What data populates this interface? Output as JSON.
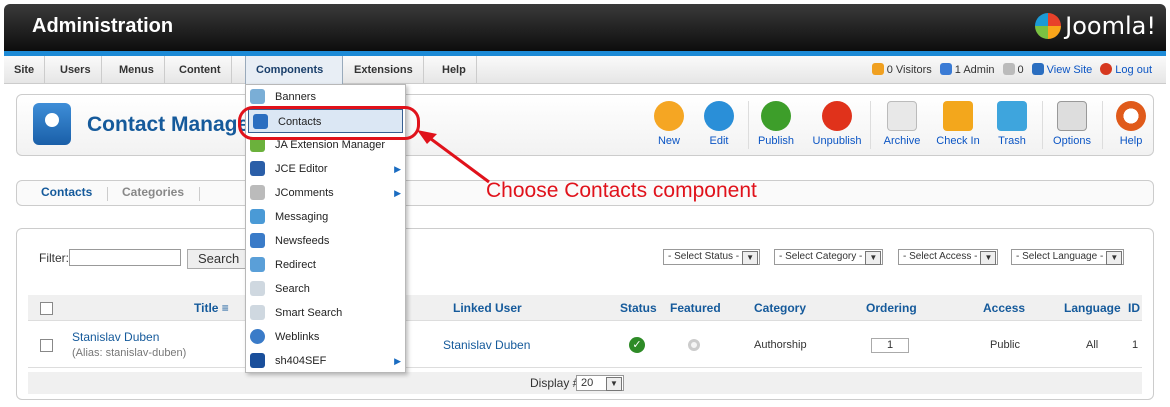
{
  "header": {
    "title": "Administration",
    "logo_text": "Joomla!"
  },
  "menubar": {
    "items": [
      "Site",
      "Users",
      "Menus",
      "Content",
      "Components",
      "Extensions",
      "Help"
    ],
    "active": "Components"
  },
  "status": {
    "visitors": "0 Visitors",
    "admin": "1 Admin",
    "messages": "0",
    "view_site": "View Site",
    "logout": "Log out"
  },
  "toolbar": {
    "page_title": "Contact Manage",
    "buttons": [
      "New",
      "Edit",
      "Publish",
      "Unpublish",
      "Archive",
      "Check In",
      "Trash",
      "Options",
      "Help"
    ]
  },
  "subnav": {
    "items": [
      "Contacts",
      "Categories"
    ],
    "active": "Contacts"
  },
  "filter": {
    "label": "Filter:",
    "value": "",
    "search_label": "Search"
  },
  "selects": [
    "- Select Status -",
    "- Select Category -",
    "- Select Access -",
    "- Select Language -"
  ],
  "table": {
    "columns": [
      "Title",
      "Linked User",
      "Status",
      "Featured",
      "Category",
      "Ordering",
      "Access",
      "Language",
      "ID"
    ],
    "rows": [
      {
        "title": "Stanislav Duben",
        "alias": "(Alias: stanislav-duben)",
        "linked_user": "Stanislav Duben",
        "status": "published",
        "featured": "no",
        "category": "Authorship",
        "ordering": "1",
        "access": "Public",
        "language": "All",
        "id": "1"
      }
    ]
  },
  "footer": {
    "display_label": "Display #",
    "display_value": "20"
  },
  "dropdown": {
    "items": [
      {
        "label": "Banners",
        "icon": "banner-icon",
        "submenu": false
      },
      {
        "label": "Contacts",
        "icon": "contacts-icon",
        "submenu": false
      },
      {
        "label": "JA Extension Manager",
        "icon": "extension-manager-icon",
        "submenu": false
      },
      {
        "label": "JCE Editor",
        "icon": "editor-icon",
        "submenu": true
      },
      {
        "label": "JComments",
        "icon": "comments-icon",
        "submenu": true
      },
      {
        "label": "Messaging",
        "icon": "messaging-icon",
        "submenu": false
      },
      {
        "label": "Newsfeeds",
        "icon": "rss-icon",
        "submenu": false
      },
      {
        "label": "Redirect",
        "icon": "redirect-icon",
        "submenu": false
      },
      {
        "label": "Search",
        "icon": "search-icon",
        "submenu": false
      },
      {
        "label": "Smart Search",
        "icon": "smart-search-icon",
        "submenu": false
      },
      {
        "label": "Weblinks",
        "icon": "weblinks-icon",
        "submenu": false
      },
      {
        "label": "sh404SEF",
        "icon": "sef-icon",
        "submenu": true
      }
    ],
    "highlighted": "Contacts"
  },
  "annotation": {
    "text": "Choose Contacts component"
  },
  "colors": {
    "accent": "#155a9b",
    "annotation": "#e0121b",
    "menu_strip": "#1c8ad6"
  }
}
